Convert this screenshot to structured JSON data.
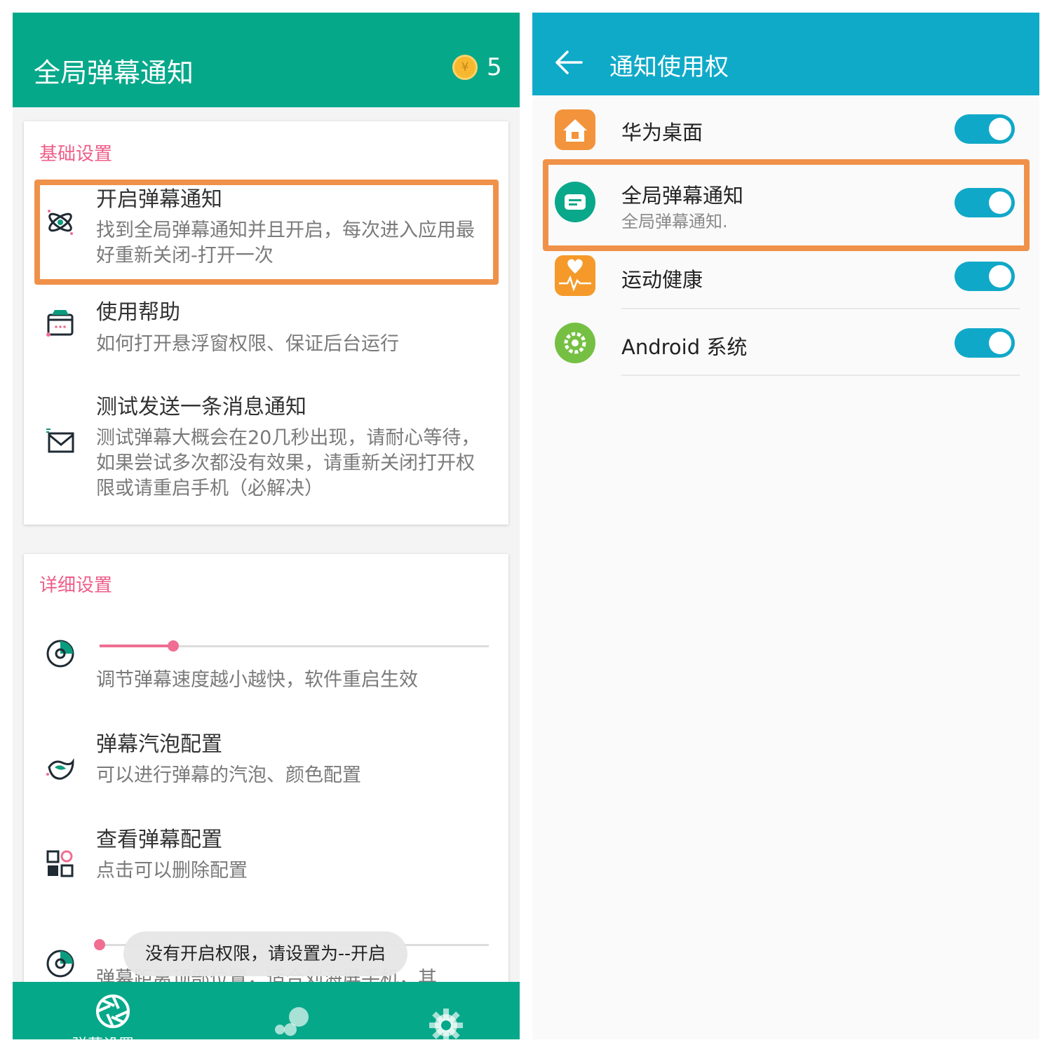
{
  "left_screen": {
    "title": "全局弹幕通知",
    "coin_symbol": "¥",
    "coin_count": "5",
    "basic_section": {
      "title": "基础设置",
      "items": [
        {
          "title": "开启弹幕通知",
          "desc": "找到全局弹幕通知并且开启，每次进入应用最好重新关闭-打开一次",
          "icon": "atom-icon"
        },
        {
          "title": "使用帮助",
          "desc": "如何打开悬浮窗权限、保证后台运行",
          "icon": "help-box-icon"
        },
        {
          "title": "测试发送一条消息通知",
          "desc": "测试弹幕大概会在20几秒出现，请耐心等待，如果尝试多次都没有效果，请重新关闭打开权限或请重启手机（必解决）",
          "icon": "envelope-icon"
        }
      ]
    },
    "detail_section": {
      "title": "详细设置",
      "speed_slider": {
        "value_fraction": 0.19,
        "desc": "调节弹幕速度越小越快，软件重启生效",
        "icon": "speed-dial-icon"
      },
      "items": [
        {
          "title": "弹幕汽泡配置",
          "desc": "可以进行弹幕的汽泡、颜色配置",
          "icon": "bird-icon"
        },
        {
          "title": "查看弹幕配置",
          "desc": "点击可以删除配置",
          "icon": "grid-config-icon"
        }
      ],
      "position_slider": {
        "value_fraction": 0.0,
        "desc": "弹幕距离顶部位置，适合刘海屏手机，其",
        "icon": "position-dial-icon"
      }
    },
    "toast": "没有开启权限，请设置为--开启",
    "bottom_nav": {
      "tabs": [
        {
          "label": "弹幕设置",
          "icon": "aperture-icon"
        },
        {
          "label": "",
          "icon": "dots-icon"
        },
        {
          "label": "",
          "icon": "gear-icon"
        }
      ]
    }
  },
  "right_screen": {
    "title": "通知使用权",
    "apps": [
      {
        "name": "华为桌面",
        "sub": "",
        "icon": "home-app-icon",
        "enabled": true
      },
      {
        "name": "全局弹幕通知",
        "sub": "全局弹幕通知.",
        "icon": "danmaku-app-icon",
        "enabled": true
      },
      {
        "name": "运动健康",
        "sub": "",
        "icon": "health-app-icon",
        "enabled": true
      },
      {
        "name": "Android 系统",
        "sub": "",
        "icon": "android-system-icon",
        "enabled": true
      }
    ]
  },
  "colors": {
    "left_bar": "#06a88a",
    "right_bar": "#10aac9",
    "accent_pink": "#ee5e88",
    "highlight_orange": "#f0914a",
    "toggle_on": "#10a8c8"
  }
}
